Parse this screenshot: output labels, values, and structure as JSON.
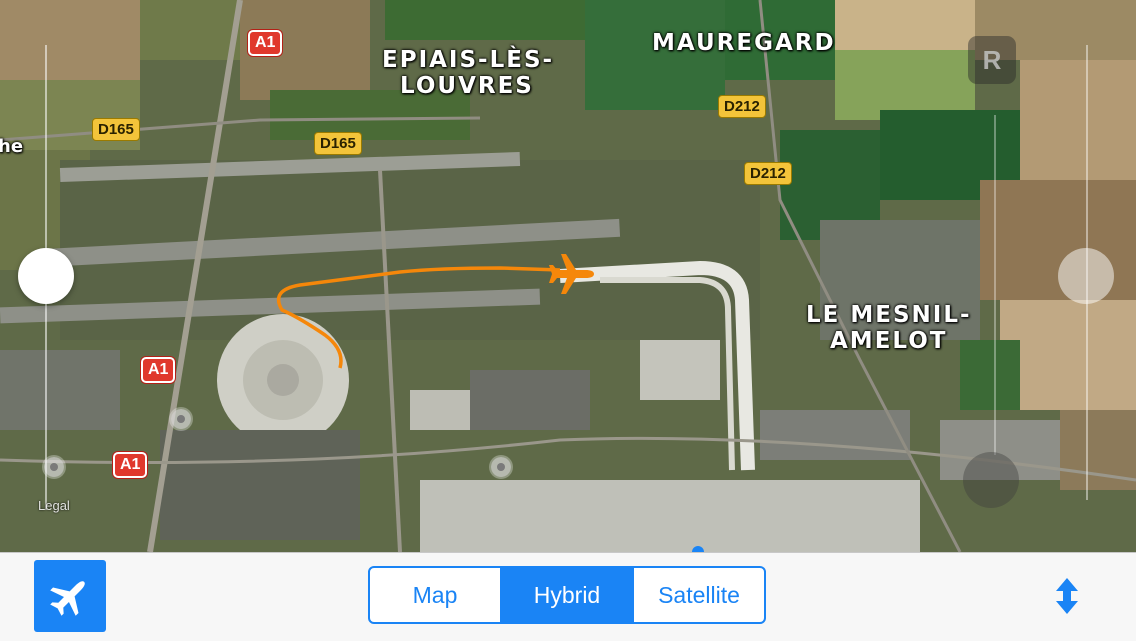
{
  "map": {
    "places": [
      "MAUREGARD",
      "EPIAIS-LÈS-",
      "LOUVRES",
      "LE MESNIL-",
      "AMELOT"
    ],
    "partial_label_left": "he",
    "road_labels": [
      "D165",
      "D165",
      "D212",
      "D212"
    ],
    "motorway_labels": [
      "A1",
      "A1",
      "A1"
    ],
    "legal_label": "Legal",
    "rotate_button_label": "R"
  },
  "toolbar": {
    "map_types": [
      "Map",
      "Hybrid",
      "Satellite"
    ],
    "selected_map_type": "Hybrid",
    "flight_button_icon": "airplane-icon",
    "expand_icon": "up-down-arrow-icon"
  },
  "colors": {
    "accent": "#1a84f5",
    "flight_path": "#f5870a"
  }
}
